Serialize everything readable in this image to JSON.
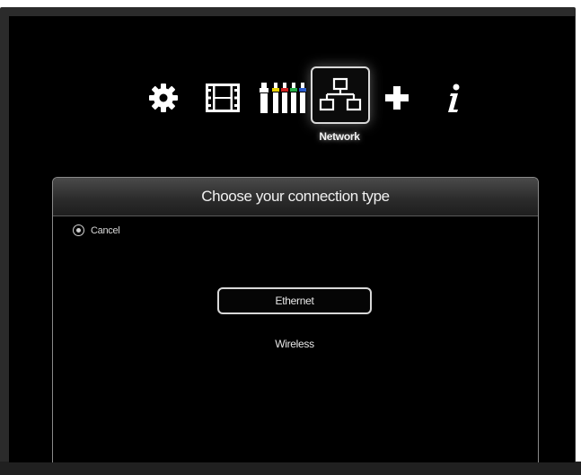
{
  "menu": {
    "items": [
      {
        "id": "settings",
        "icon": "gear-icon"
      },
      {
        "id": "video",
        "icon": "film-strip-icon"
      },
      {
        "id": "audio-video-connectors",
        "icon": "av-connectors-icon"
      },
      {
        "id": "network",
        "icon": "network-icon",
        "label": "Network",
        "selected": true
      },
      {
        "id": "add",
        "icon": "plus-icon"
      },
      {
        "id": "info",
        "icon": "info-icon"
      }
    ],
    "selected_label": "Network"
  },
  "dialog": {
    "title": "Choose your connection type",
    "cancel_label": "Cancel",
    "options": [
      {
        "label": "Ethernet",
        "selected": true
      },
      {
        "label": "Wireless",
        "selected": false
      }
    ]
  },
  "colors": {
    "background": "#000000",
    "connector_yellow": "#e8d000",
    "connector_red": "#cc2020",
    "connector_green": "#22aa44",
    "connector_blue": "#2255cc"
  }
}
